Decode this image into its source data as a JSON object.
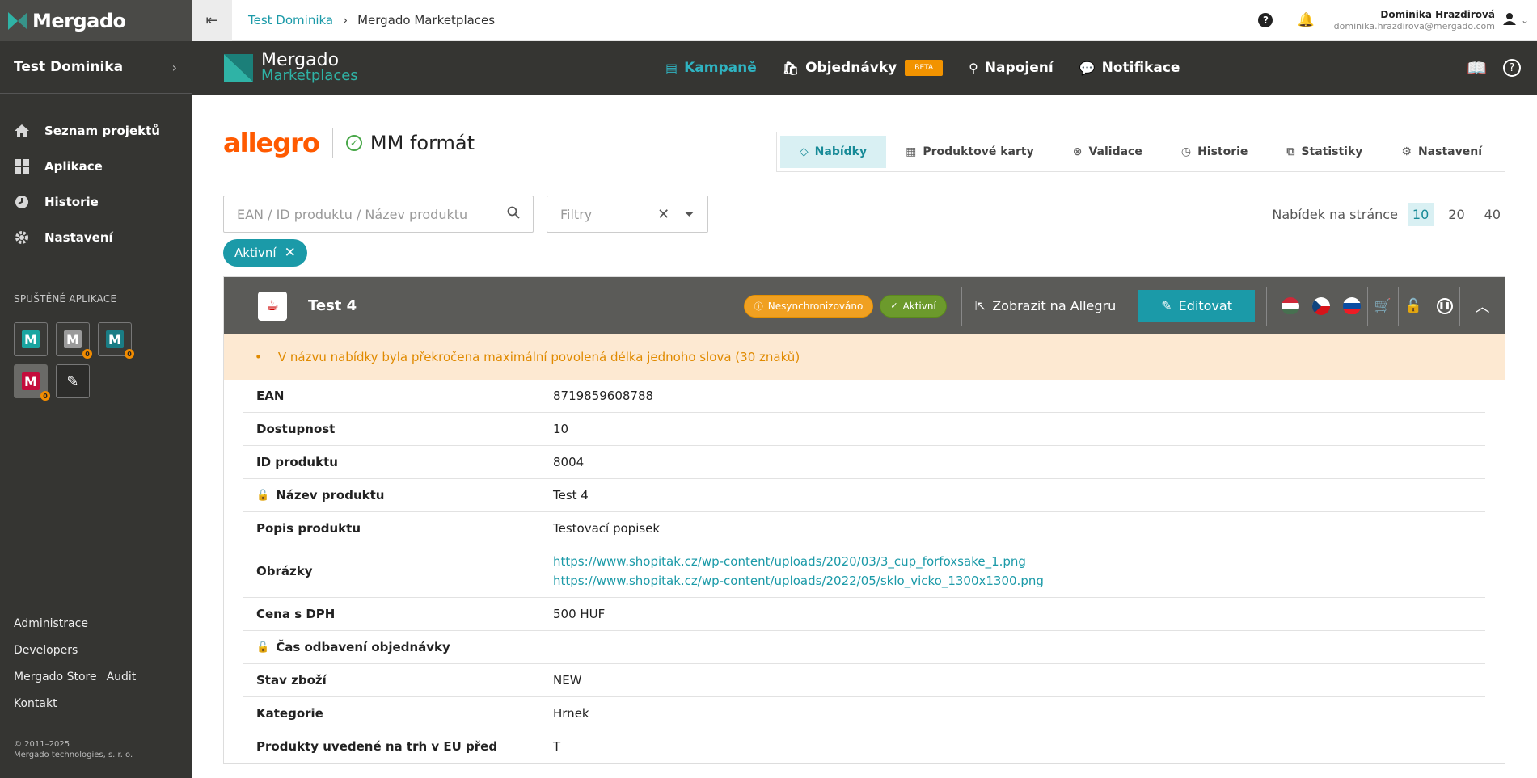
{
  "sidebar": {
    "logo": "Mergado",
    "project": "Test Dominika",
    "nav": [
      {
        "label": "Seznam projektů",
        "icon": "home-icon"
      },
      {
        "label": "Aplikace",
        "icon": "apps-grid-icon"
      },
      {
        "label": "Historie",
        "icon": "history-clock-icon"
      },
      {
        "label": "Nastavení",
        "icon": "gear-icon"
      }
    ],
    "apps_title": "SPUŠTĚNÉ APLIKACE",
    "apps": [
      {
        "letter": "M",
        "color": "#1aa5a0",
        "badge": ""
      },
      {
        "letter": "M",
        "color": "#9a9a9a",
        "badge": "0"
      },
      {
        "letter": "M",
        "color": "#1a7d85",
        "badge": "0"
      },
      {
        "letter": "M",
        "color": "#c40d3c",
        "badge": "0"
      }
    ],
    "footer": {
      "administrace": "Administrace",
      "developers": "Developers",
      "store": "Mergado Store",
      "audit": "Audit",
      "kontakt": "Kontakt",
      "copyright1": "© 2011–2025",
      "copyright2": "Mergado technologies, s. r. o."
    }
  },
  "topbar": {
    "crumb_link": "Test Dominika",
    "crumb_current": "Mergado Marketplaces",
    "user_name": "Dominika Hrazdirová",
    "user_email": "dominika.hrazdirova@mergado.com"
  },
  "apphdr": {
    "title": "Mergado",
    "subtitle": "Marketplaces",
    "nav": {
      "kampane": "Kampaně",
      "objednavky": "Objednávky",
      "beta": "BETA",
      "napojeni": "Napojení",
      "notifikace": "Notifikace"
    }
  },
  "page": {
    "brand": "allegro",
    "format": "MM formát",
    "tabs": {
      "nabidky": "Nabídky",
      "karty": "Produktové karty",
      "validace": "Validace",
      "historie": "Historie",
      "statistiky": "Statistiky",
      "nastaveni": "Nastavení"
    },
    "search_placeholder": "EAN / ID produktu / Název produktu",
    "filter_placeholder": "Filtry",
    "perpage_label": "Nabídek na stránce",
    "perpage": [
      "10",
      "20",
      "40"
    ],
    "chip": "Aktivní"
  },
  "offer": {
    "title": "Test 4",
    "badge_sync": "Nesynchronizováno",
    "badge_active": "Aktivní",
    "show_link": "Zobrazit na Allegru",
    "edit": "Editovat",
    "warning": "V názvu nabídky byla překročena maximální povolená délka jednoho slova (30 znaků)",
    "rows": {
      "ean_k": "EAN",
      "ean_v": "8719859608788",
      "dost_k": "Dostupnost",
      "dost_v": "10",
      "id_k": "ID produktu",
      "id_v": "8004",
      "nazev_k": "Název produktu",
      "nazev_v": "Test 4",
      "popis_k": "Popis produktu",
      "popis_v": "Testovací popisek",
      "obr_k": "Obrázky",
      "obr_1": "https://www.shopitak.cz/wp-content/uploads/2020/03/3_cup_forfoxsake_1.png",
      "obr_2": "https://www.shopitak.cz/wp-content/uploads/2022/05/sklo_vicko_1300x1300.png",
      "cena_k": "Cena s DPH",
      "cena_v": "500 HUF",
      "cas_k": "Čas odbavení objednávky",
      "cas_v": "",
      "stav_k": "Stav zboží",
      "stav_v": "NEW",
      "kat_k": "Kategorie",
      "kat_v": "Hrnek",
      "trh_k": "Produkty uvedené na trh v EU před",
      "trh_v": "T"
    }
  }
}
